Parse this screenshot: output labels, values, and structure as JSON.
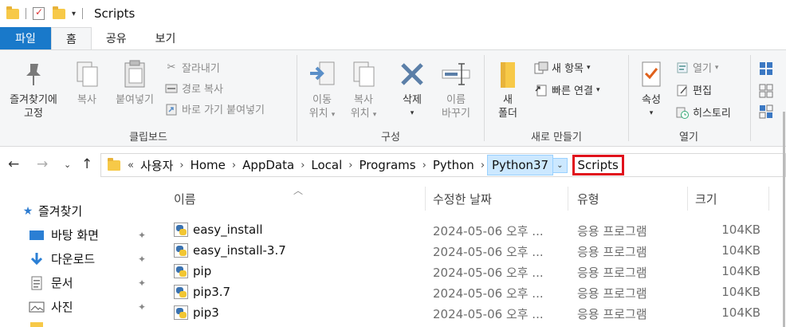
{
  "window": {
    "title": "Scripts"
  },
  "tabs": [
    "파일",
    "홈",
    "공유",
    "보기"
  ],
  "ribbon": {
    "clipboard": {
      "label": "클립보드",
      "pin_label_1": "즐겨찾기에",
      "pin_label_2": "고정",
      "copy": "복사",
      "paste": "붙여넣기",
      "cut": "잘라내기",
      "copy_path": "경로 복사",
      "paste_shortcut": "바로 가기 붙여넣기"
    },
    "organize": {
      "label": "구성",
      "move_1": "이동",
      "move_2": "위치",
      "copyto_1": "복사",
      "copyto_2": "위치",
      "delete": "삭제",
      "rename_1": "이름",
      "rename_2": "바꾸기"
    },
    "new": {
      "label": "새로 만들기",
      "new_folder_1": "새",
      "new_folder_2": "폴더",
      "new_item": "새 항목",
      "easy_access": "빠른 연결"
    },
    "open": {
      "label": "열기",
      "properties": "속성",
      "open": "열기",
      "edit": "편집",
      "history": "히스토리"
    }
  },
  "address": {
    "overflow": "«",
    "crumbs": [
      "사용자",
      "Home",
      "AppData",
      "Local",
      "Programs",
      "Python",
      "Python37"
    ],
    "current": "Scripts"
  },
  "columns": {
    "name": "이름",
    "date": "수정한 날짜",
    "type": "유형",
    "size": "크기"
  },
  "nav": {
    "favorites": "즐겨찾기",
    "items": [
      "바탕 화면",
      "다운로드",
      "문서",
      "사진"
    ]
  },
  "files": [
    {
      "name": "easy_install",
      "date": "2024-05-06 오후 ...",
      "type": "응용 프로그램",
      "size": "104KB"
    },
    {
      "name": "easy_install-3.7",
      "date": "2024-05-06 오후 ...",
      "type": "응용 프로그램",
      "size": "104KB"
    },
    {
      "name": "pip",
      "date": "2024-05-06 오후 ...",
      "type": "응용 프로그램",
      "size": "104KB"
    },
    {
      "name": "pip3.7",
      "date": "2024-05-06 오후 ...",
      "type": "응용 프로그램",
      "size": "104KB"
    },
    {
      "name": "pip3",
      "date": "2024-05-06 오후 ...",
      "type": "응용 프로그램",
      "size": "104KB"
    }
  ],
  "colors": {
    "file_tab": "#1979ca",
    "highlight": "#cce8ff",
    "box": "#e0111c",
    "folder": "#f7c948"
  }
}
